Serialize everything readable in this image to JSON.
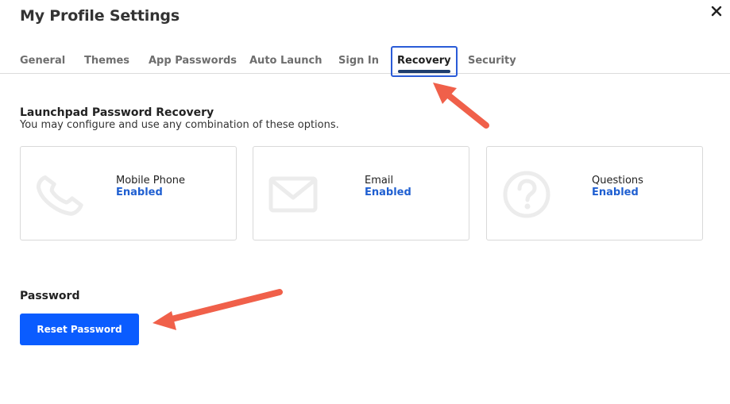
{
  "window": {
    "title": "My Profile Settings"
  },
  "tabs": [
    {
      "label": "General"
    },
    {
      "label": "Themes"
    },
    {
      "label": "App Passwords"
    },
    {
      "label": "Auto Launch"
    },
    {
      "label": "Sign In"
    },
    {
      "label": "Recovery",
      "active": true
    },
    {
      "label": "Security"
    }
  ],
  "recovery": {
    "title": "Launchpad Password Recovery",
    "subtitle": "You may configure and use any combination of these options.",
    "options": [
      {
        "label": "Mobile Phone",
        "status": "Enabled",
        "icon": "phone-icon"
      },
      {
        "label": "Email",
        "status": "Enabled",
        "icon": "envelope-icon"
      },
      {
        "label": "Questions",
        "status": "Enabled",
        "icon": "question-icon"
      }
    ]
  },
  "password": {
    "title": "Password",
    "reset_label": "Reset Password"
  },
  "colors": {
    "accent": "#0a5cff",
    "status_blue": "#1f5fd1",
    "annotation_arrow": "#f0604a"
  }
}
